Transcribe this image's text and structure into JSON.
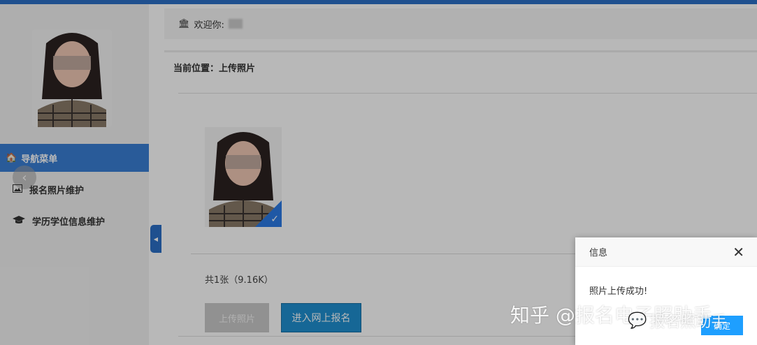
{
  "header": {
    "welcome_text": "欢迎你:"
  },
  "sidebar": {
    "nav_title": "导航菜单",
    "items": [
      {
        "label": "报名照片维护",
        "icon": "image-icon"
      },
      {
        "label": "学历学位信息维护",
        "icon": "graduation-cap-icon"
      }
    ]
  },
  "main": {
    "location": "当前位置：上传照片",
    "photo_count": "共1张（9.16K）",
    "upload_label": "上传照片",
    "enter_label": "进入网上报名"
  },
  "dialog": {
    "title": "信息",
    "message": "照片上传成功!",
    "confirm_label": "确定"
  },
  "watermark": {
    "line1": "知乎 @报名电子照助手",
    "line2": "报名照助手"
  },
  "colors": {
    "accent": "#2c6fc6",
    "primary_button": "#1f8fd0",
    "dialog_button": "#1e9fff"
  }
}
